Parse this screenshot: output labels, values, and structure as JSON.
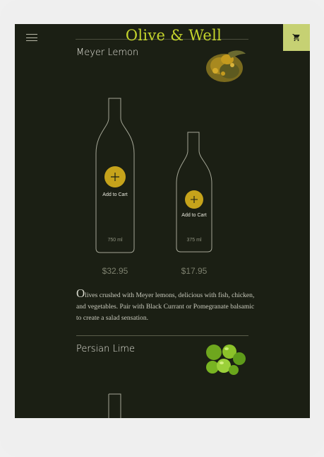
{
  "app": {
    "brand": "Olive & Well",
    "icons": {
      "menu": "hamburger-menu-icon",
      "cart": "shopping-cart-icon",
      "add": "plus-icon"
    },
    "colors": {
      "background": "#1b1f14",
      "logo": "#c4d42c",
      "cart_button": "#c6d173",
      "add_button": "#c6a31b"
    }
  },
  "products": [
    {
      "name": "Meyer Lemon",
      "image": "meyer-lemon-image",
      "sizes": [
        {
          "size": "750 ml",
          "add_label": "Add to Cart",
          "price": "$32.95"
        },
        {
          "size": "375 ml",
          "add_label": "Add to Cart",
          "price": "$17.95"
        }
      ],
      "description_dropcap": "O",
      "description_rest": "lives crushed with Meyer lemons, delicious with fish, chicken, and vegetables. Pair with Black Currant or Pomegranate balsamic to create a salad sensation."
    },
    {
      "name": "Persian Lime",
      "image": "persian-lime-image"
    }
  ]
}
